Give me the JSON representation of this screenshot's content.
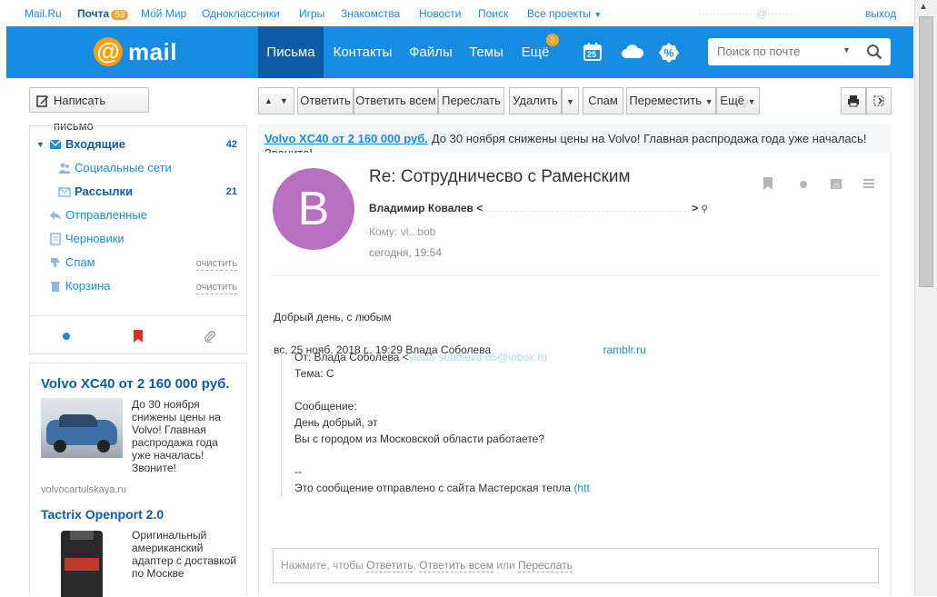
{
  "portal": {
    "links": [
      "Mail.Ru",
      "Почта",
      "Мой Мир",
      "Одноклассники",
      "Игры",
      "Знакомства",
      "Новости",
      "Поиск",
      "Все проекты"
    ],
    "mail_badge": "63",
    "logout": "выход"
  },
  "header": {
    "logo_text": "mail",
    "tabs": [
      "Письма",
      "Контакты",
      "Файлы",
      "Темы",
      "Ещё"
    ],
    "more_badge": "3",
    "calendar_day": "25",
    "search_placeholder": "Поиск по почте"
  },
  "compose_label": "Написать письмо",
  "toolbar": {
    "reply": "Ответить",
    "reply_all": "Ответить всем",
    "forward": "Переслать",
    "delete": "Удалить",
    "spam": "Спам",
    "move": "Переместить",
    "more": "Ещё"
  },
  "folders": [
    {
      "label": "Входящие",
      "count": "42"
    },
    {
      "label": "Социальные сети",
      "count": ""
    },
    {
      "label": "Рассылки",
      "count": "21"
    },
    {
      "label": "Отправленные",
      "count": ""
    },
    {
      "label": "Черновики",
      "count": ""
    },
    {
      "label": "Спам",
      "clear": "очистить"
    },
    {
      "label": "Корзина",
      "clear": "очистить"
    }
  ],
  "ads": [
    {
      "title": "Volvo XC40 от 2 160 000 руб.",
      "text": "До 30 ноября снижены цены на Volvo! Главная распродажа года уже началась! Звоните!",
      "domain": "volvocartulskaya.ru"
    },
    {
      "title": "Tactrix Openport 2.0",
      "text": "Оригинальный американский адаптер с доставкой по Москве",
      "domain": ""
    }
  ],
  "banner": {
    "link": "Volvo XC40 от 2 160 000 руб.",
    "text": "До 30 ноября снижены цены на Volvo! Главная распродажа года уже началась! Звоните!"
  },
  "message": {
    "avatar_letter": "В",
    "subject": "Re: Сотрудничесво с Раменским",
    "from": "Владимир Ковалев <",
    "from_tail": "> ",
    "to_label": "Кому:",
    "to_value": "vl...bob",
    "date": "сегодня, 19:54",
    "greeting": "Добрый день, с любым",
    "quote_header": "вс, 25 нояб. 2018 г., 19:29 Влада Соболева",
    "quote_header_link": "ramblr.ru",
    "quote_from": "От: Влада Соболева <",
    "quote_from_link": "vlada-soboleva.65@inbox.ru",
    "quote_subject": "Тема: С",
    "quote_message_label": "Сообщение:",
    "quote_line1": "День добрый, эт",
    "quote_line2": "Вы с городом из Московской области работаете?",
    "quote_sig": "--",
    "quote_footer": "Это сообщение отправлено с сайта Мастерская тепла",
    "quote_footer_link": "(htt",
    "reply_prefix": "Нажмите, чтобы",
    "reply_link1": "Ответить",
    "reply_link2": "Ответить всем",
    "reply_or": "или",
    "reply_link3": "Переслать"
  }
}
